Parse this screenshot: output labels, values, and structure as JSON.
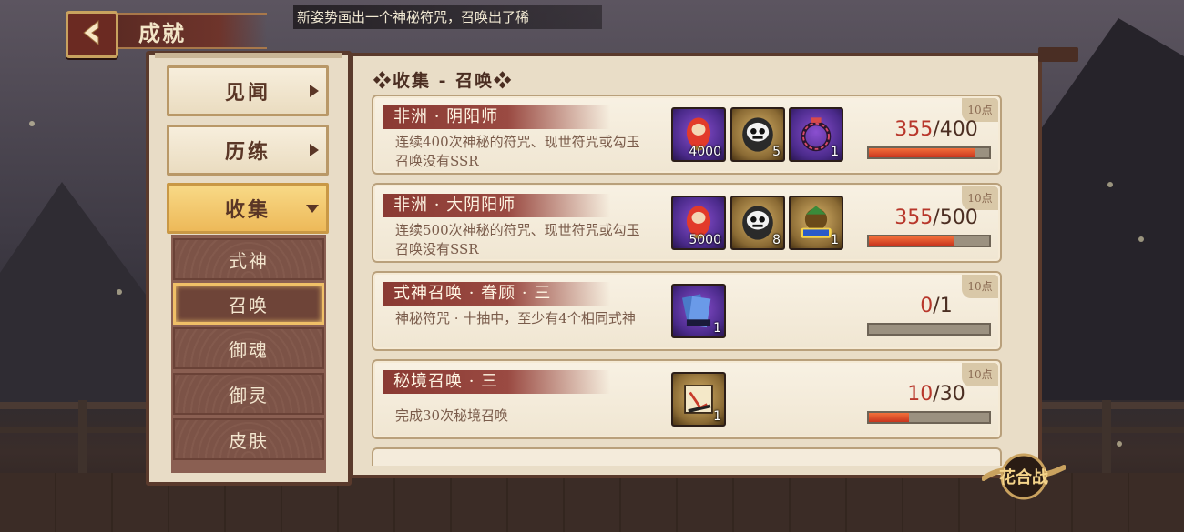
{
  "header": {
    "back_icon": "chevron-left-icon",
    "title": "成就",
    "marquee": "新姿势画出一个神秘符咒，召唤出了稀"
  },
  "sidebar": {
    "categories": [
      {
        "label": "见闻",
        "state": "collapsed"
      },
      {
        "label": "历练",
        "state": "collapsed"
      },
      {
        "label": "收集",
        "state": "expanded"
      }
    ],
    "subitems": [
      {
        "label": "式神",
        "selected": false
      },
      {
        "label": "召唤",
        "selected": true
      },
      {
        "label": "御魂",
        "selected": false
      },
      {
        "label": "御灵",
        "selected": false
      },
      {
        "label": "皮肤",
        "selected": false
      }
    ]
  },
  "main": {
    "section_title": "❖收集 - 召唤❖",
    "achievements": [
      {
        "title": "非洲 · 阴阳师",
        "desc": "连续400次神秘的符咒、现世符咒或勾玉召唤没有SSR",
        "points": "10点",
        "rewards": [
          {
            "icon": "red-daruma-icon",
            "count": "4000"
          },
          {
            "icon": "skull-daruma-icon",
            "count": "5"
          },
          {
            "icon": "magatama-necklace-icon",
            "count": "1"
          }
        ],
        "progress_current": "355",
        "progress_total": "/400",
        "progress_fraction": 0.8875
      },
      {
        "title": "非洲 · 大阴阳师",
        "desc": "连续500次神秘的符咒、现世符咒或勾玉召唤没有SSR",
        "points": "10点",
        "rewards": [
          {
            "icon": "red-daruma-icon",
            "count": "5000"
          },
          {
            "icon": "skull-daruma-icon",
            "count": "8"
          },
          {
            "icon": "ssr-shard-icon",
            "count": "1"
          }
        ],
        "progress_current": "355",
        "progress_total": "/500",
        "progress_fraction": 0.71
      },
      {
        "title": "式神召唤 · 眷顾 · 三",
        "desc": "神秘符咒 · 十抽中，至少有4个相同式神",
        "points": "10点",
        "rewards": [
          {
            "icon": "blue-talisman-icon",
            "count": "1"
          }
        ],
        "progress_current": "0",
        "progress_total": "/1",
        "progress_fraction": 0
      },
      {
        "title": "秘境召唤 · 三",
        "desc": "完成30次秘境召唤",
        "points": "10点",
        "rewards": [
          {
            "icon": "scroll-frame-icon",
            "count": "1"
          }
        ],
        "progress_current": "10",
        "progress_total": "/30",
        "progress_fraction": 0.333
      }
    ]
  },
  "badge": {
    "icon": "huahezhan-badge-icon",
    "text": "花合战"
  },
  "colors": {
    "accent_red": "#b8372b",
    "progress_fill": "#e0522c",
    "selected_gold": "#f0c067"
  }
}
